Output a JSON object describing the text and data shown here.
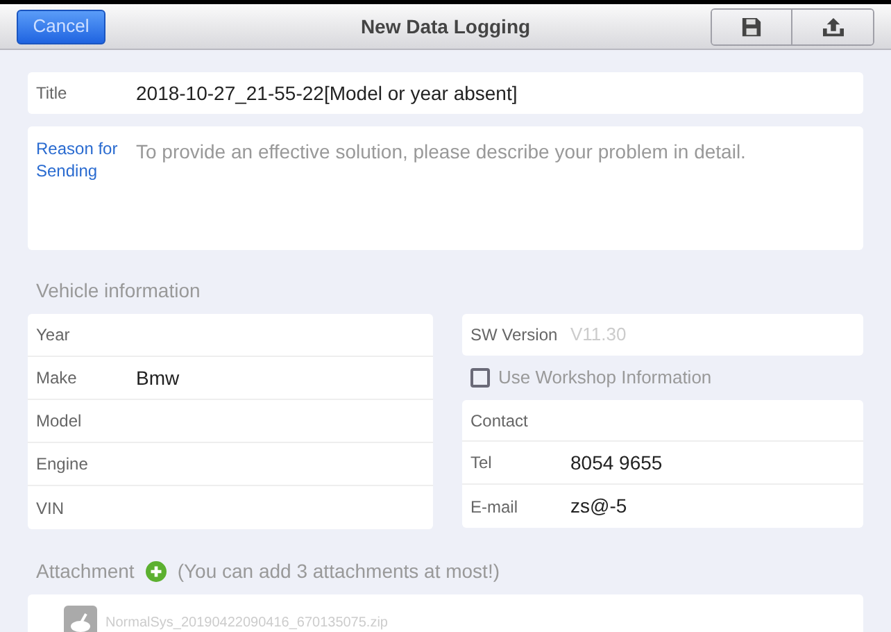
{
  "header": {
    "cancel": "Cancel",
    "title": "New Data Logging"
  },
  "title_field": {
    "label": "Title",
    "value": "2018-10-27_21-55-22[Model or year absent]"
  },
  "reason_field": {
    "label": "Reason for Sending",
    "placeholder": "To provide an effective solution, please describe your problem in detail."
  },
  "vehicle_information": {
    "heading": "Vehicle information",
    "fields": [
      {
        "label": "Year"
      },
      {
        "label": "Make",
        "value": "Bmw"
      },
      {
        "label": "Model"
      },
      {
        "label": "Engine"
      },
      {
        "label": "VIN"
      }
    ]
  },
  "sw_version": {
    "label": "SW Version",
    "value": "V11.30"
  },
  "use_workshop_information": {
    "label": "Use Workshop Information",
    "checked": false
  },
  "contact": {
    "heading": "Contact",
    "fields": [
      {
        "label": "Tel",
        "value": "8054 9655"
      },
      {
        "label": "E-mail",
        "value": "zs@-5"
      }
    ]
  },
  "attachment": {
    "heading": "Attachment",
    "note": "(You can add 3 attachments at most!)",
    "files": [
      {
        "name": "NormalSys_20190422090416_670135075.zip"
      }
    ]
  }
}
